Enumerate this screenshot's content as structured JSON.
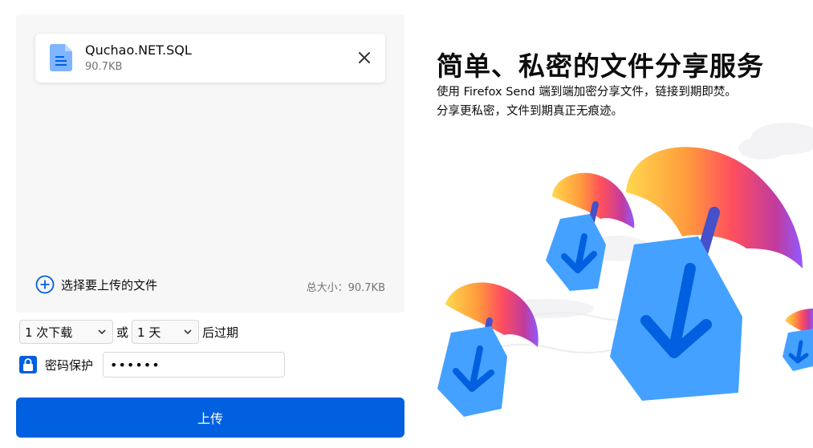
{
  "file": {
    "name": "Quchao.NET.SQL",
    "size": "90.7KB"
  },
  "upload_area": {
    "add_files_label": "选择要上传的文件",
    "total_size": "总大小：90.7KB"
  },
  "expiry": {
    "downloads_value": "1 次下载",
    "or_text": "或",
    "time_value": "1 天",
    "suffix": "后过期"
  },
  "password": {
    "label": "密码保护",
    "value": "••••••",
    "checked": true
  },
  "upload_button_label": "上传",
  "intro": {
    "title": "简单、私密的文件分享服务",
    "description": "使用 Firefox Send 端到端加密分享文件，链接到期即焚。分享更私密，文件到期真正无痕迹。"
  },
  "colors": {
    "accent": "#0060df",
    "panel_bg": "#f7f7f7",
    "muted_text": "#737373"
  },
  "icons": [
    "file-icon",
    "close-icon",
    "add-circle-icon",
    "chevron-down-icon",
    "lock-icon"
  ]
}
